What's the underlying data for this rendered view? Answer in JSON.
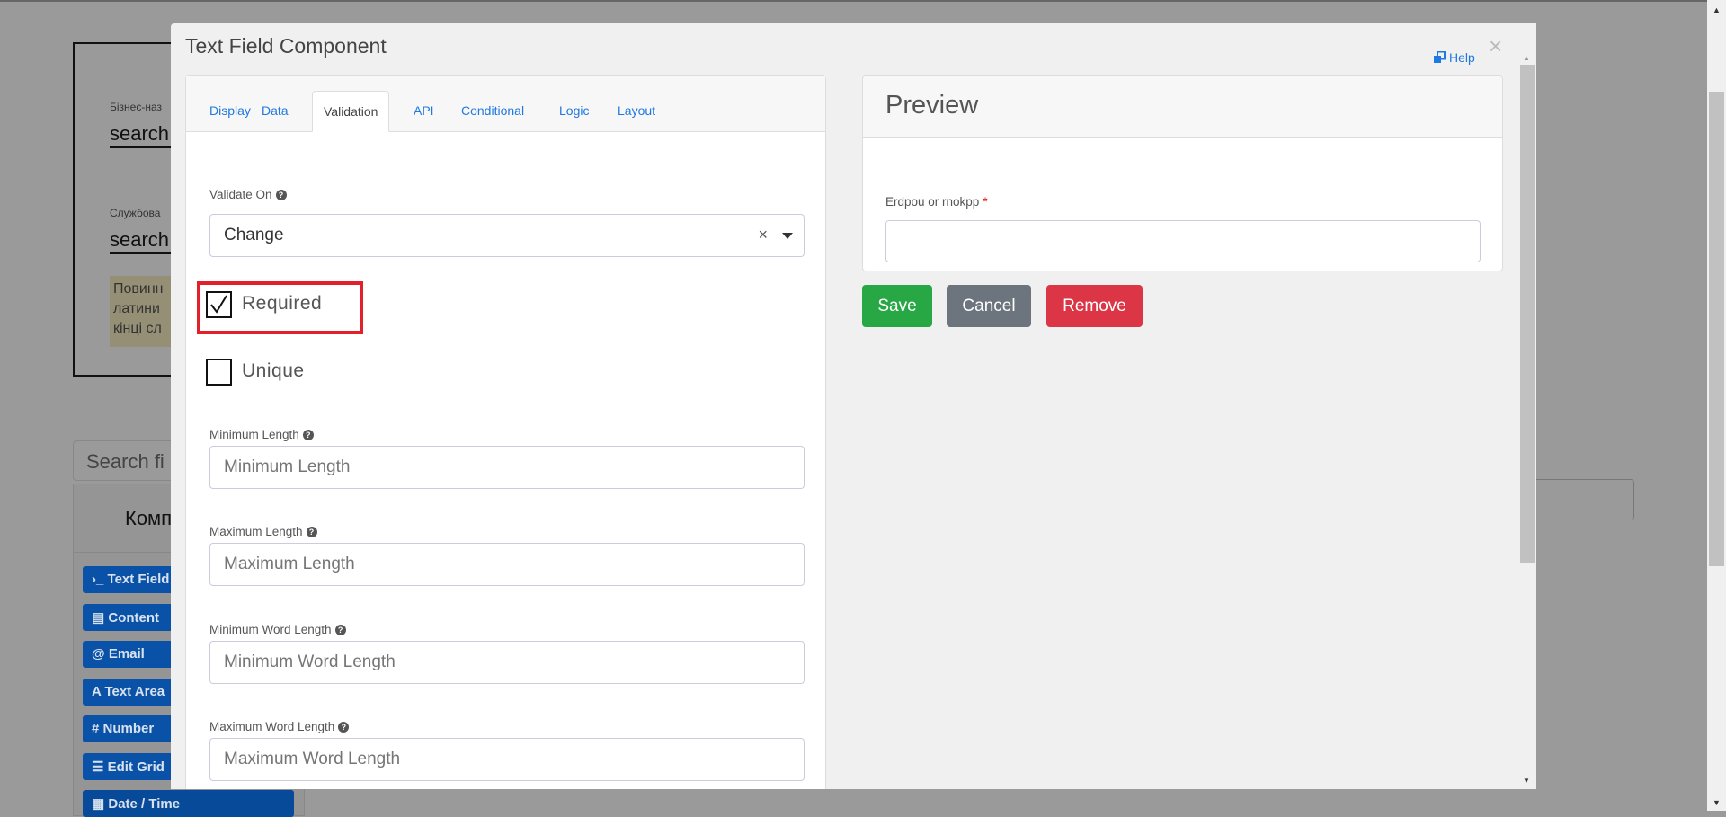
{
  "background": {
    "business_label": "Бізнес-наз",
    "business_value": "search",
    "service_label": "Службова",
    "service_value": "search",
    "note_lines": [
      "Повинн",
      "латини",
      "кінці сл"
    ],
    "search_placeholder": "Search fi",
    "components_header": "Комп",
    "component_buttons": [
      {
        "icon": "terminal-icon",
        "glyph": "›_",
        "label": "Text Field"
      },
      {
        "icon": "html5-icon",
        "glyph": "▤",
        "label": "Content"
      },
      {
        "icon": "at-icon",
        "glyph": "@",
        "label": "Email"
      },
      {
        "icon": "font-icon",
        "glyph": "A",
        "label": "Text Area"
      },
      {
        "icon": "hashtag-icon",
        "glyph": "#",
        "label": "Number"
      },
      {
        "icon": "list-icon",
        "glyph": "☰",
        "label": "Edit Grid"
      },
      {
        "icon": "calendar-icon",
        "glyph": "▦",
        "label": "Date / Time"
      }
    ]
  },
  "modal": {
    "title": "Text Field Component",
    "help_label": "Help",
    "close_glyph": "×",
    "tabs": [
      {
        "label": "Display",
        "active": false
      },
      {
        "label": "Data",
        "active": false
      },
      {
        "label": "Validation",
        "active": true
      },
      {
        "label": "API",
        "active": false
      },
      {
        "label": "Conditional",
        "active": false
      },
      {
        "label": "Logic",
        "active": false
      },
      {
        "label": "Layout",
        "active": false
      }
    ],
    "validate_on": {
      "label": "Validate On",
      "value": "Change"
    },
    "required": {
      "label": "Required",
      "checked": true
    },
    "unique": {
      "label": "Unique",
      "checked": false
    },
    "fields": [
      {
        "label": "Minimum Length",
        "placeholder": "Minimum Length",
        "value": ""
      },
      {
        "label": "Maximum Length",
        "placeholder": "Maximum Length",
        "value": ""
      },
      {
        "label": "Minimum Word Length",
        "placeholder": "Minimum Word Length",
        "value": ""
      },
      {
        "label": "Maximum Word Length",
        "placeholder": "Maximum Word Length",
        "value": ""
      }
    ],
    "preview": {
      "title": "Preview",
      "field_label": "Erdpou or rnokpp",
      "required_mark": "*",
      "field_value": ""
    },
    "buttons": {
      "save": "Save",
      "cancel": "Cancel",
      "remove": "Remove"
    }
  },
  "colors": {
    "save": "#28a745",
    "cancel": "#6c757d",
    "remove": "#dc3545",
    "link": "#2079e0",
    "highlight": "#e3202a"
  }
}
